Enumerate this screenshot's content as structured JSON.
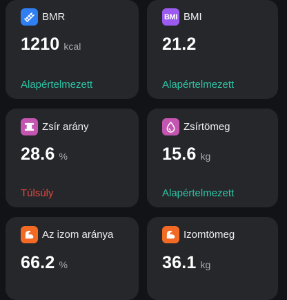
{
  "colors": {
    "page_background": "#121316",
    "card_background": "#26272b",
    "status_normal": "#2fc4a5",
    "status_high": "#e5473f"
  },
  "cards": [
    {
      "id": "bmr",
      "label": "BMR",
      "value": "1210",
      "unit": "kcal",
      "status": "Alapértelmezett",
      "status_color": "#2fc4a5",
      "icon": {
        "name": "bmr-icon",
        "color": "#2f7ff2",
        "text": ""
      }
    },
    {
      "id": "bmi",
      "label": "BMI",
      "value": "21.2",
      "unit": "",
      "status": "Alapértelmezett",
      "status_color": "#2fc4a5",
      "icon": {
        "name": "bmi-icon",
        "color": "#9b5bf0",
        "text": "BMI"
      }
    },
    {
      "id": "fat-ratio",
      "label": "Zsír arány",
      "value": "28.6",
      "unit": "%",
      "status": "Túlsúly",
      "status_color": "#e5473f",
      "icon": {
        "name": "body-fat-icon",
        "color": "#c455b0",
        "text": ""
      }
    },
    {
      "id": "fat-mass",
      "label": "Zsírtömeg",
      "value": "15.6",
      "unit": "kg",
      "status": "Alapértelmezett",
      "status_color": "#2fc4a5",
      "icon": {
        "name": "fat-drop-icon",
        "color": "#c455b0",
        "text": ""
      }
    },
    {
      "id": "muscle-ratio",
      "label": "Az izom aránya",
      "value": "66.2",
      "unit": "%",
      "status": "",
      "status_color": "#2fc4a5",
      "icon": {
        "name": "muscle-arm-icon",
        "color": "#f26a24",
        "text": ""
      }
    },
    {
      "id": "muscle-mass",
      "label": "Izomtömeg",
      "value": "36.1",
      "unit": "kg",
      "status": "",
      "status_color": "#2fc4a5",
      "icon": {
        "name": "muscle-arm-icon",
        "color": "#f26a24",
        "text": ""
      }
    }
  ]
}
